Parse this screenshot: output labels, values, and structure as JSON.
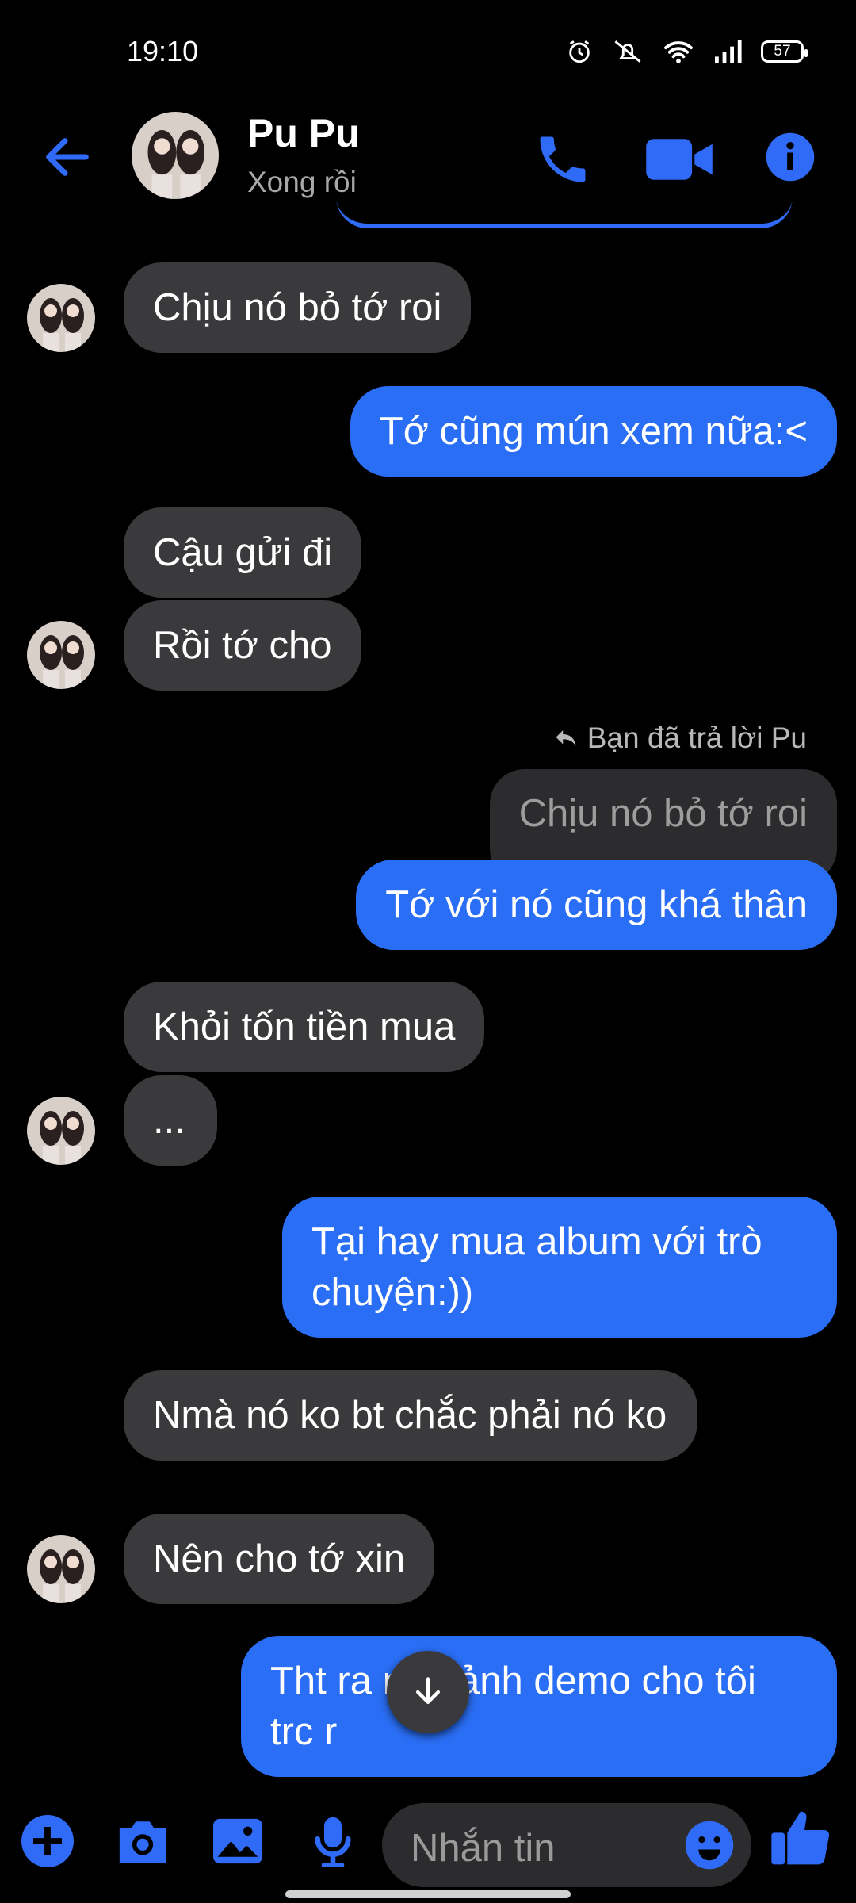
{
  "status_bar": {
    "time": "19:10",
    "battery": "57",
    "icons": [
      "alarm-icon",
      "mute-icon",
      "wifi-icon",
      "signal-icon",
      "battery-icon"
    ]
  },
  "header": {
    "name": "Pu Pu",
    "status": "Xong rồi"
  },
  "messages": [
    {
      "from": "them",
      "text": "Chịu nó bỏ tớ roi"
    },
    {
      "from": "me",
      "text": "Tớ cũng mún xem nữa:<"
    },
    {
      "from": "them",
      "text": "Cậu gửi đi"
    },
    {
      "from": "them",
      "text": "Rồi tớ cho"
    },
    {
      "from": "me",
      "text": "Tớ với nó cũng khá thân",
      "reply_note": "Bạn đã trả lời Pu",
      "quoted": "Chịu nó bỏ tớ roi"
    },
    {
      "from": "them",
      "text": "Khỏi tốn tiền mua"
    },
    {
      "from": "them",
      "text": "..."
    },
    {
      "from": "me",
      "text": "Tại hay mua album với trò chuyện:))"
    },
    {
      "from": "them",
      "text": "Nmà nó ko bt chắc phải nó ko"
    },
    {
      "from": "them",
      "text": "Nên cho tớ xin"
    },
    {
      "from": "me",
      "text": "Tht ra nhả ảnh demo cho tôi trc r"
    }
  ],
  "composer": {
    "placeholder": "Nhắn tin"
  },
  "colors": {
    "accent": "#2a6ef5",
    "incoming_bubble": "#3a3a3c",
    "background": "#000000"
  }
}
